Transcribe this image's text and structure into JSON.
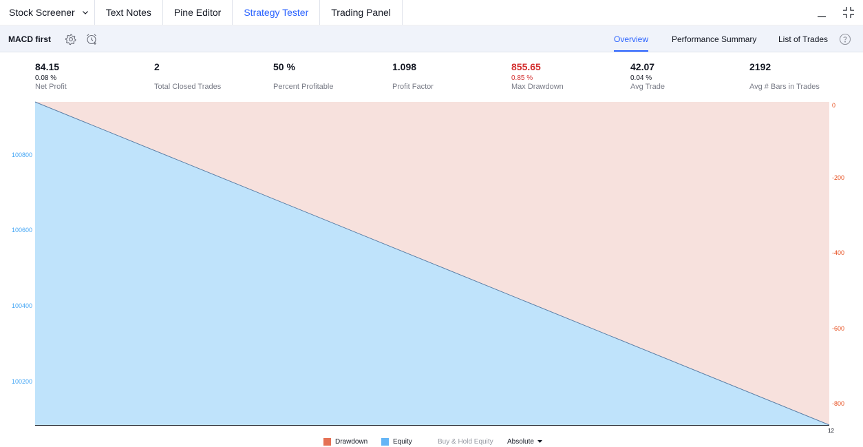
{
  "tabs": [
    {
      "label": "Stock Screener",
      "has_dropdown": true,
      "active": false
    },
    {
      "label": "Text Notes",
      "active": false
    },
    {
      "label": "Pine Editor",
      "active": false
    },
    {
      "label": "Strategy Tester",
      "active": true
    },
    {
      "label": "Trading Panel",
      "active": false
    }
  ],
  "toolbar": {
    "strategy_name": "MACD first",
    "icons": [
      "gear-icon",
      "alarm-add-icon"
    ],
    "report_tabs": [
      {
        "label": "Overview",
        "active": true
      },
      {
        "label": "Performance Summary",
        "active": false
      },
      {
        "label": "List of Trades",
        "active": false
      }
    ],
    "help_icon": "question-circle-icon"
  },
  "metrics": [
    {
      "value": "84.15",
      "percent": "0.08 %",
      "label": "Net Profit",
      "negative": false
    },
    {
      "value": "2",
      "percent": "",
      "label": "Total Closed Trades",
      "negative": false
    },
    {
      "value": "50 %",
      "percent": "",
      "label": "Percent Profitable",
      "negative": false
    },
    {
      "value": "1.098",
      "percent": "",
      "label": "Profit Factor",
      "negative": false
    },
    {
      "value": "855.65",
      "percent": "0.85 %",
      "label": "Max Drawdown",
      "negative": true
    },
    {
      "value": "42.07",
      "percent": "0.04 %",
      "label": "Avg Trade",
      "negative": false
    },
    {
      "value": "2192",
      "percent": "",
      "label": "Avg # Bars in Trades",
      "negative": false
    }
  ],
  "chart_data": {
    "type": "area",
    "left_axis": {
      "ticks": [
        "100800",
        "100600",
        "100400",
        "100200"
      ],
      "color": "#42a5f5"
    },
    "right_axis": {
      "ticks": [
        "0",
        "-200",
        "-400",
        "-600",
        "-800"
      ],
      "color": "#e64a19"
    },
    "x_ticks": [
      "12"
    ],
    "series": [
      {
        "name": "Equity",
        "color": "#bfe3fb"
      },
      {
        "name": "Drawdown",
        "color": "#f7e1dd"
      }
    ]
  },
  "legend": {
    "items": [
      {
        "label": "Drawdown",
        "color": "#e57155"
      },
      {
        "label": "Equity",
        "color": "#64b5f6"
      },
      {
        "label": "Buy & Hold Equity",
        "color": ""
      }
    ],
    "mode_label": "Absolute"
  },
  "colors": {
    "accent": "#2962ff",
    "negative": "#d32f2f",
    "toolbar_bg": "#f0f3fa"
  }
}
